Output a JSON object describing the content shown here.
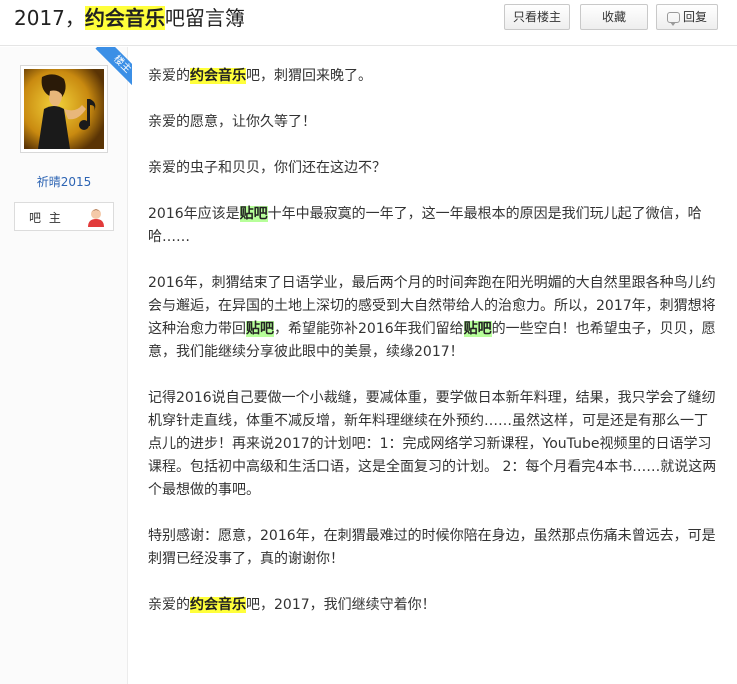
{
  "header": {
    "title_prefix": "2017，",
    "title_highlight": "约会音乐",
    "title_suffix": "吧留言簿",
    "btn_only_op": "只看楼主",
    "btn_favorite": "收藏",
    "btn_reply": "回复"
  },
  "author": {
    "badge": "楼主",
    "name": "祈晴2015",
    "role": "吧 主"
  },
  "post": {
    "p1_pre": "亲爱的",
    "p1_hl": "约会音乐",
    "p1_post": "吧，刺猬回来晚了。",
    "p2": "亲爱的愿意，让你久等了！",
    "p3": "亲爱的虫子和贝贝，你们还在这边不？",
    "p4_pre": "2016年应该是",
    "p4_hl": "贴吧",
    "p4_post": "十年中最寂寞的一年了，这一年最根本的原因是我们玩儿起了微信，哈哈……",
    "p5_a": "2016年，刺猬结束了日语学业，最后两个月的时间奔跑在阳光明媚的大自然里跟各种鸟儿约会与邂逅，在异国的土地上深切的感受到大自然带给人的治愈力。所以，2017年，刺猬想将这种治愈力带回",
    "p5_hl1": "贴吧",
    "p5_b": "，希望能弥补2016年我们留给",
    "p5_hl2": "贴吧",
    "p5_c": "的一些空白！也希望虫子，贝贝，愿意，我们能继续分享彼此眼中的美景，续缘2017！",
    "p6": "记得2016说自己要做一个小裁缝，要减体重，要学做日本新年料理，结果，我只学会了缝纫机穿针走直线，体重不减反增，新年料理继续在外预约……虽然这样，可是还是有那么一丁点儿的进步！再来说2017的计划吧：1：完成网络学习新课程，YouTube视频里的日语学习课程。包括初中高级和生活口语，这是全面复习的计划。 2：每个月看完4本书……就说这两个最想做的事吧。",
    "p7": "特别感谢：愿意，2016年，在刺猬最难过的时候你陪在身边，虽然那点伤痛未曾远去，可是刺猬已经没事了，真的谢谢你！",
    "p8_pre": "亲爱的",
    "p8_hl": "约会音乐",
    "p8_post": "吧，2017，我们继续守着你！"
  },
  "colors": {
    "highlight_yellow": "#ffff3b",
    "highlight_green": "#b7ff9a",
    "username_blue": "#2d64b3",
    "badge_blue": "#3b8fe6"
  }
}
